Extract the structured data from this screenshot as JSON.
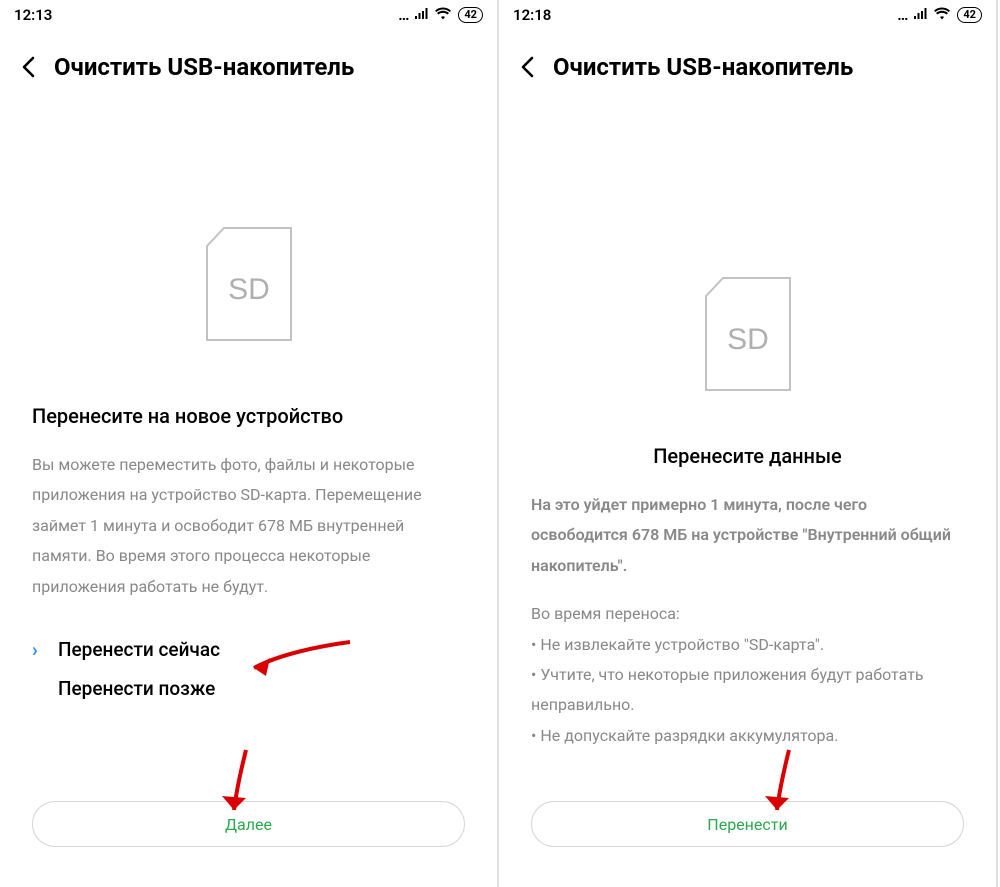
{
  "left": {
    "status": {
      "time": "12:13",
      "battery": "42"
    },
    "header": {
      "title": "Очистить USB-накопитель"
    },
    "sd_label": "SD",
    "subtitle": "Перенесите на новое устройство",
    "body": "Вы можете переместить фото, файлы и некоторые приложения на устройство SD-карта. Перемещение займет 1 минута и освободит 678 МБ внутренней памяти. Во время этого процесса некоторые приложения работать не будут.",
    "option_now": "Перенести сейчас",
    "option_later": "Перенести позже",
    "button": "Далее"
  },
  "right": {
    "status": {
      "time": "12:18",
      "battery": "42"
    },
    "header": {
      "title": "Очистить USB-накопитель"
    },
    "sd_label": "SD",
    "subtitle": "Перенесите данные",
    "body1": "На это уйдет примерно 1 минута, после чего освободится 678 МБ на устройстве \"Внутренний общий накопитель\".",
    "body2_label": "Во время переноса:",
    "bullet1": "• Не извлекайте устройство \"SD-карта\".",
    "bullet2": "• Учтите, что некоторые приложения будут работать неправильно.",
    "bullet3": "• Не допускайте разрядки аккумулятора.",
    "button": "Перенести"
  }
}
